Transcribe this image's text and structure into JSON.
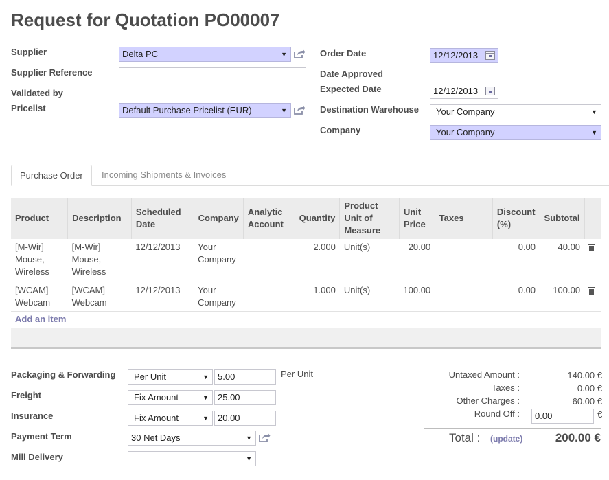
{
  "title": "Request for Quotation PO00007",
  "header_left": {
    "supplier_label": "Supplier",
    "supplier_value": "Delta PC",
    "supplier_ref_label": "Supplier Reference",
    "supplier_ref_value": "",
    "validated_by_label": "Validated by",
    "pricelist_label": "Pricelist",
    "pricelist_value": "Default Purchase Pricelist (EUR)"
  },
  "header_right": {
    "order_date_label": "Order Date",
    "order_date_value": "12/12/2013",
    "date_approved_label": "Date Approved",
    "expected_date_label": "Expected Date",
    "expected_date_value": "12/12/2013",
    "warehouse_label": "Destination Warehouse",
    "warehouse_value": "Your Company",
    "company_label": "Company",
    "company_value": "Your Company"
  },
  "tabs": [
    {
      "label": "Purchase Order",
      "active": true
    },
    {
      "label": "Incoming Shipments & Invoices",
      "active": false
    }
  ],
  "columns": [
    "Product",
    "Description",
    "Scheduled Date",
    "Company",
    "Analytic Account",
    "Quantity",
    "Product Unit of Measure",
    "Unit Price",
    "Taxes",
    "Discount (%)",
    "Subtotal"
  ],
  "rows": [
    {
      "product": "[M-Wir] Mouse, Wireless",
      "description": "[M-Wir] Mouse, Wireless",
      "date": "12/12/2013",
      "company": "Your Company",
      "analytic": "",
      "quantity": "2.000",
      "uom": "Unit(s)",
      "unit_price": "20.00",
      "taxes": "",
      "discount": "0.00",
      "subtotal": "40.00"
    },
    {
      "product": "[WCAM] Webcam",
      "description": "[WCAM] Webcam",
      "date": "12/12/2013",
      "company": "Your Company",
      "analytic": "",
      "quantity": "1.000",
      "uom": "Unit(s)",
      "unit_price": "100.00",
      "taxes": "",
      "discount": "0.00",
      "subtotal": "100.00"
    }
  ],
  "add_item_label": "Add an item",
  "charges": {
    "packaging_label": "Packaging & Forwarding",
    "packaging_type": "Per Unit",
    "packaging_amount": "5.00",
    "packaging_suffix": "Per Unit",
    "freight_label": "Freight",
    "freight_type": "Fix Amount",
    "freight_amount": "25.00",
    "insurance_label": "Insurance",
    "insurance_type": "Fix Amount",
    "insurance_amount": "20.00",
    "payment_term_label": "Payment Term",
    "payment_term_value": "30 Net Days",
    "mill_delivery_label": "Mill Delivery",
    "mill_delivery_value": ""
  },
  "totals": {
    "untaxed_label": "Untaxed Amount :",
    "untaxed_value": "140.00 €",
    "taxes_label": "Taxes :",
    "taxes_value": "0.00 €",
    "other_label": "Other Charges :",
    "other_value": "60.00 €",
    "roundoff_label": "Round Off :",
    "roundoff_value": "0.00",
    "roundoff_currency": "€",
    "total_label": "Total :",
    "update_label": "(update)",
    "total_value": "200.00 €"
  },
  "colors": {
    "required_bg": "#d2d2ff",
    "link": "#7c7bad",
    "header_bg": "#ececec"
  }
}
